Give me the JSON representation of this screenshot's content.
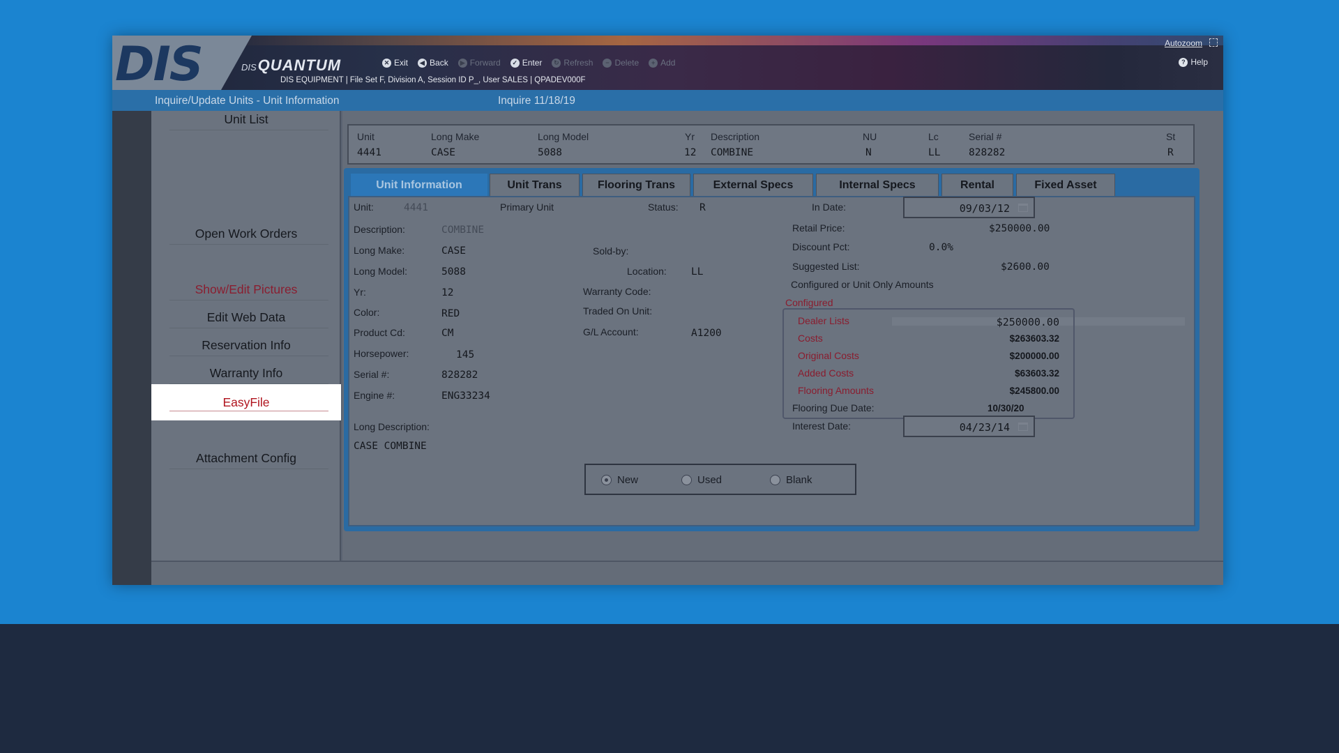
{
  "app": {
    "logo": "DIS",
    "brand_prefix": "DIS",
    "brand_name": "QUANTUM",
    "autozoom": "Autozoom",
    "session": "DIS EQUIPMENT | File Set F, Division A, Session ID P_, User SALES | QPADEV000F"
  },
  "toolbar": {
    "exit": "Exit",
    "back": "Back",
    "forward": "Forward",
    "enter": "Enter",
    "refresh": "Refresh",
    "delete": "Delete",
    "add": "Add",
    "help": "Help"
  },
  "titlebar": {
    "title": "Inquire/Update Units - Unit Information",
    "mode": "Inquire 11/18/19"
  },
  "sidebar": {
    "items": [
      {
        "label": "Unit List"
      },
      {
        "label": "Open Work Orders"
      },
      {
        "label": "Show/Edit Pictures"
      },
      {
        "label": "Edit Web Data"
      },
      {
        "label": "Reservation Info"
      },
      {
        "label": "Warranty Info"
      },
      {
        "label": "EasyFile"
      },
      {
        "label": "Attachment Config"
      }
    ]
  },
  "unit_header": {
    "columns": [
      "Unit",
      "Long Make",
      "Long Model",
      "Yr",
      "Description",
      "NU",
      "Lc",
      "Serial #",
      "St"
    ],
    "values": [
      "4441",
      "CASE",
      "5088",
      "12",
      "COMBINE",
      "N",
      "LL",
      "828282",
      "R"
    ]
  },
  "tabs": [
    {
      "label": "Unit Information"
    },
    {
      "label": "Unit Trans"
    },
    {
      "label": "Flooring Trans"
    },
    {
      "label": "External Specs"
    },
    {
      "label": "Internal Specs"
    },
    {
      "label": "Rental"
    },
    {
      "label": "Fixed Asset"
    }
  ],
  "form": {
    "unit_label": "Unit:",
    "unit": "4441",
    "primary_unit": "Primary Unit",
    "status_label": "Status:",
    "status": "R",
    "in_date_label": "In Date:",
    "in_date": "09/03/12",
    "description_label": "Description:",
    "description": "COMBINE",
    "retail_label": "Retail Price:",
    "retail": "$250000.00",
    "long_make_label": "Long Make:",
    "long_make": "CASE",
    "sold_by_label": "Sold-by:",
    "discount_label": "Discount Pct:",
    "discount": "0.0%",
    "long_model_label": "Long Model:",
    "long_model": "5088",
    "location_label": "Location:",
    "location": "LL",
    "suggested_label": "Suggested List:",
    "suggested": "$2600.00",
    "configured_or_unit": "Configured or Unit Only Amounts",
    "yr_label": "Yr:",
    "yr": "12",
    "warranty_label": "Warranty Code:",
    "configured": "Configured",
    "color_label": "Color:",
    "color": "RED",
    "traded_label": "Traded On Unit:",
    "product_label": "Product Cd:",
    "product": "CM",
    "gl_label": "G/L Account:",
    "gl": "A1200",
    "horsepower_label": "Horsepower:",
    "horsepower": "145",
    "serial_label": "Serial #:",
    "serial": "828282",
    "engine_label": "Engine #:",
    "engine": "ENG33234",
    "long_desc_label": "Long Description:",
    "long_desc": "CASE COMBINE",
    "flooring_due_label": "Flooring Due Date:",
    "flooring_due": "10/30/20",
    "interest_label": "Interest Date:",
    "interest": "04/23/14"
  },
  "configured_amounts": [
    {
      "label": "Dealer Lists",
      "value": "$250000.00"
    },
    {
      "label": "Costs",
      "value": "$263603.32"
    },
    {
      "label": "Original Costs",
      "value": "$200000.00"
    },
    {
      "label": "Added Costs",
      "value": "$63603.32"
    },
    {
      "label": "Flooring Amounts",
      "value": "$245800.00"
    }
  ],
  "condition": {
    "options": [
      "New",
      "Used",
      "Blank"
    ],
    "selected": "New"
  }
}
